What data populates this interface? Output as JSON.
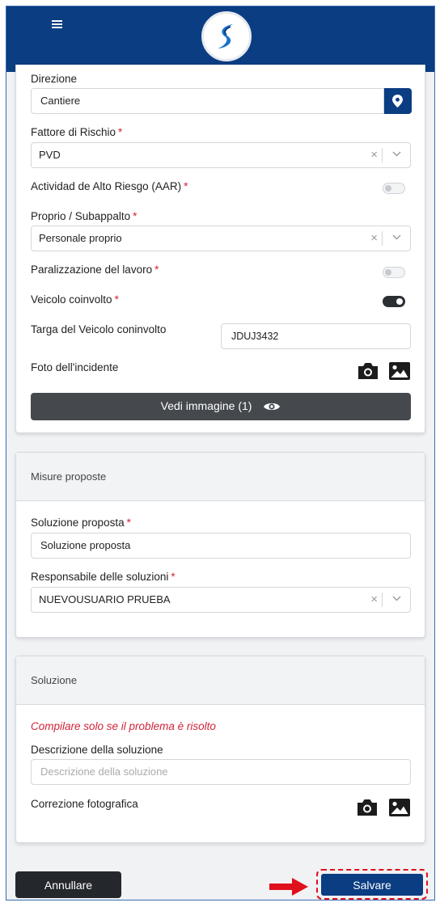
{
  "header": {
    "menu_icon": "hamburger-icon",
    "logo_icon": "brand-s-logo",
    "accent": "#0b3d82"
  },
  "incident": {
    "direzione": {
      "label": "Direzione",
      "value": "Cantiere",
      "button_icon": "map-pin-icon"
    },
    "fattore_rischio": {
      "label": "Fattore di Rischio",
      "required_mark": "*",
      "value": "PVD"
    },
    "alto_riesgo": {
      "label": "Actividad de Alto Riesgo (AAR)",
      "required_mark": "*",
      "enabled": false
    },
    "proprio": {
      "label": "Proprio / Subappalto",
      "required_mark": "*",
      "value": "Personale proprio"
    },
    "paralizzazione": {
      "label": "Paralizzazione del lavoro",
      "required_mark": "*",
      "enabled": false
    },
    "veicolo": {
      "label": "Veicolo coinvolto",
      "required_mark": "*",
      "enabled": true
    },
    "targa": {
      "label": "Targa del Veicolo coninvolto",
      "value": "JDUJ3432"
    },
    "foto": {
      "label": "Foto dell'incidente",
      "camera_icon": "camera-icon",
      "gallery_icon": "image-icon"
    },
    "view_button": {
      "label": "Vedi immagine (1)",
      "icon": "eye-icon"
    }
  },
  "misure": {
    "title": "Misure proposte",
    "soluzione": {
      "label": "Soluzione proposta",
      "required_mark": "*",
      "value": "Soluzione proposta"
    },
    "responsabile": {
      "label": "Responsabile delle soluzioni",
      "required_mark": "*",
      "value": "NUEVOUSUARIO PRUEBA"
    }
  },
  "soluzione": {
    "title": "Soluzione",
    "note": "Compilare solo se il problema è risolto",
    "descrizione": {
      "label": "Descrizione della soluzione",
      "placeholder": "Descrizione della soluzione"
    },
    "correzione": {
      "label": "Correzione fotografica",
      "camera_icon": "camera-icon",
      "gallery_icon": "image-icon"
    }
  },
  "footer": {
    "cancel_label": "Annullare",
    "save_label": "Salvare",
    "highlight_color": "#e0101c"
  },
  "select_clear_glyph": "×"
}
